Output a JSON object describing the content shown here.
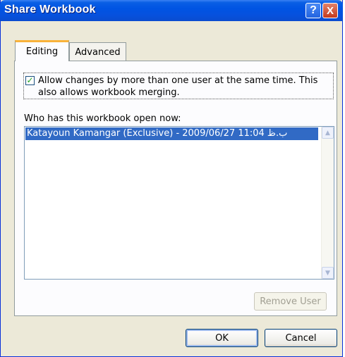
{
  "window": {
    "title": "Share Workbook"
  },
  "title_buttons": {
    "help": "?",
    "close": "X"
  },
  "tabs": [
    {
      "label": "Editing",
      "active": true
    },
    {
      "label": "Advanced",
      "active": false
    }
  ],
  "editing": {
    "allow_changes": {
      "checked": true,
      "label": "Allow changes by more than one user at the same time.  This also allows workbook merging."
    },
    "who_label": "Who has this workbook open now:",
    "users": [
      {
        "text": "Katayoun Kamangar (Exclusive) - 2009/06/27 11:04 ب.ظ",
        "selected": true
      }
    ],
    "remove_user_label": "Remove User"
  },
  "buttons": {
    "ok": "OK",
    "cancel": "Cancel"
  },
  "colors": {
    "titlebar": "#0054e3",
    "dialog_bg": "#ece9d8",
    "selection": "#316ac5",
    "tab_accent": "#f9b23a"
  }
}
